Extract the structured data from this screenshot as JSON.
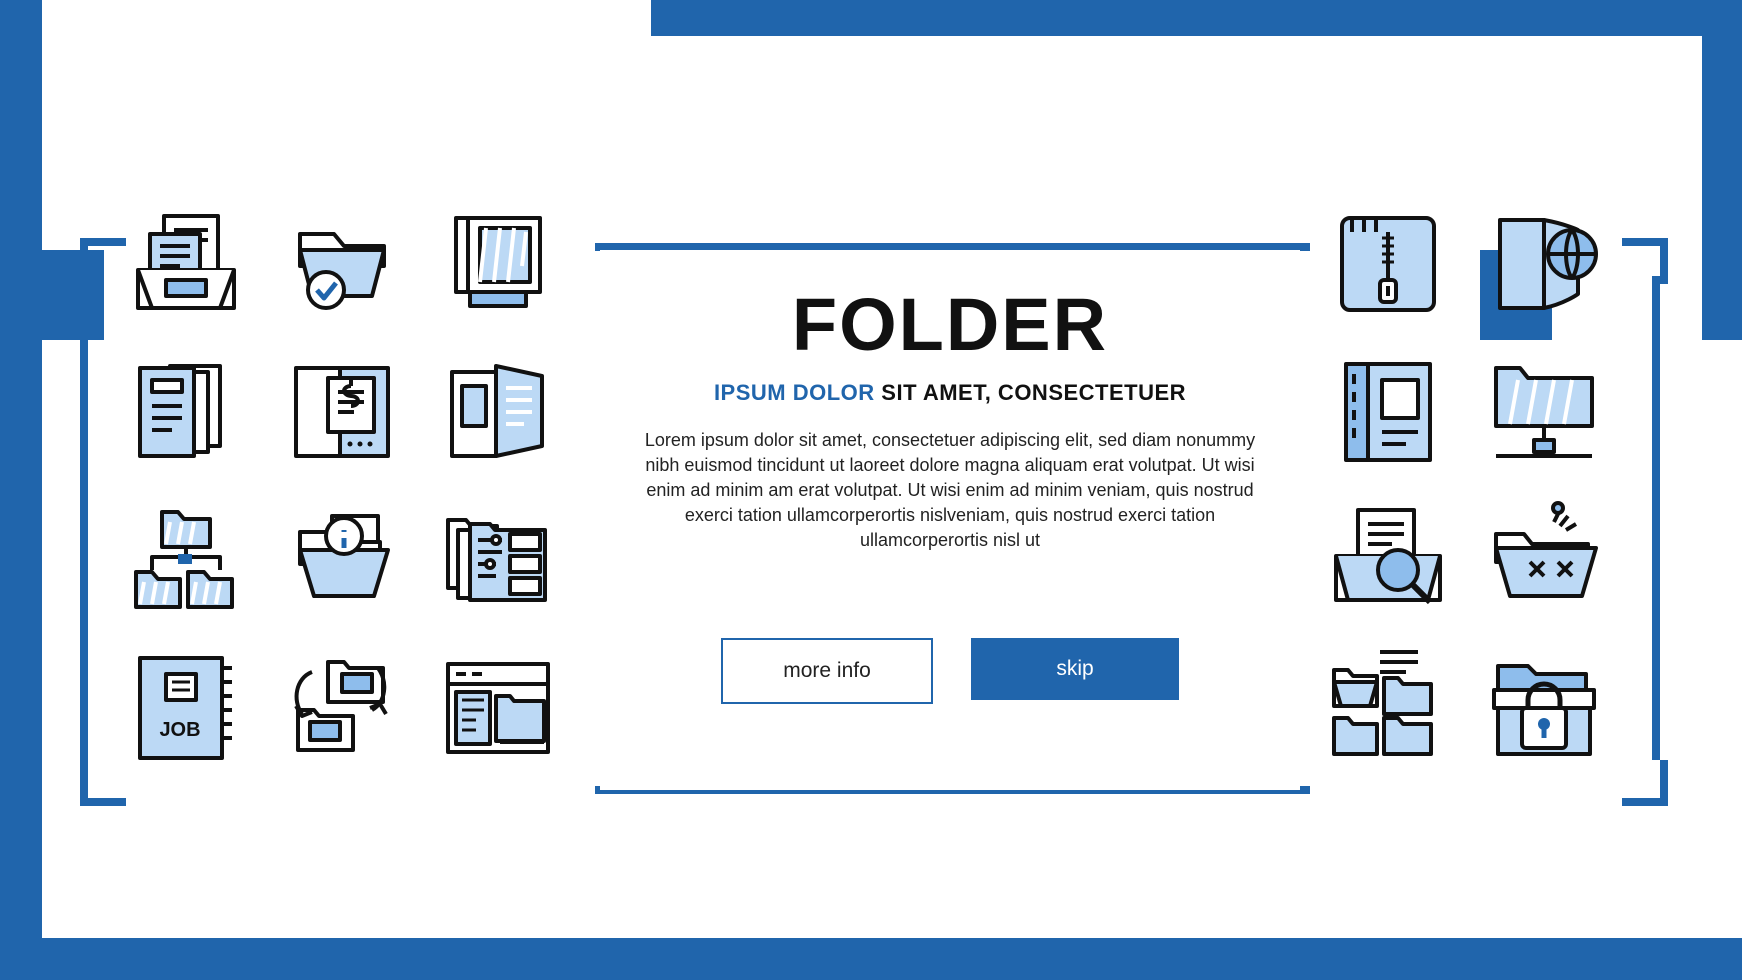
{
  "colors": {
    "accent": "#2065ac",
    "icon_fill_light": "#bcd9f5",
    "icon_fill_mid": "#8ebdec",
    "icon_stroke": "#111111",
    "background": "#ffffff",
    "text": "#111111"
  },
  "panel": {
    "title": "FOLDER",
    "subtitle_highlight": "IPSUM DOLOR",
    "subtitle_rest": "SIT AMET, CONSECTETUER",
    "body": "Lorem ipsum dolor sit amet, consectetuer adipiscing elit, sed diam nonummy nibh euismod tincidunt ut laoreet dolore magna aliquam erat volutpat. Ut wisi enim ad minim am erat volutpat. Ut wisi enim ad minim veniam, quis nostrud exerci tation ullamcorperortis nislveniam, quis nostrud exerci tation ullamcorperortis nisl ut",
    "buttons": {
      "more_info": "more info",
      "skip": "skip"
    }
  },
  "icons": {
    "left": [
      {
        "name": "folder-with-documents-icon"
      },
      {
        "name": "folder-check-approved-icon"
      },
      {
        "name": "folder-archive-box-icon"
      },
      {
        "name": "folder-document-stack-icon"
      },
      {
        "name": "folder-invoice-dollar-icon"
      },
      {
        "name": "folder-open-book-pages-icon"
      },
      {
        "name": "folder-hierarchy-structure-icon"
      },
      {
        "name": "folder-info-icon"
      },
      {
        "name": "folder-database-settings-icon"
      },
      {
        "name": "job-folder-portfolio-icon"
      },
      {
        "name": "folder-sync-transfer-icon"
      },
      {
        "name": "folder-browser-window-icon"
      }
    ],
    "right": [
      {
        "name": "folder-zipper-notebook-icon"
      },
      {
        "name": "folder-global-world-icon"
      },
      {
        "name": "folder-binder-ring-icon"
      },
      {
        "name": "folder-network-share-icon"
      },
      {
        "name": "folder-search-magnifier-icon"
      },
      {
        "name": "folder-error-cross-icon"
      },
      {
        "name": "folder-multiple-stack-icon"
      },
      {
        "name": "folder-lock-secure-icon"
      }
    ]
  },
  "labels": {
    "job_book": "JOB"
  }
}
